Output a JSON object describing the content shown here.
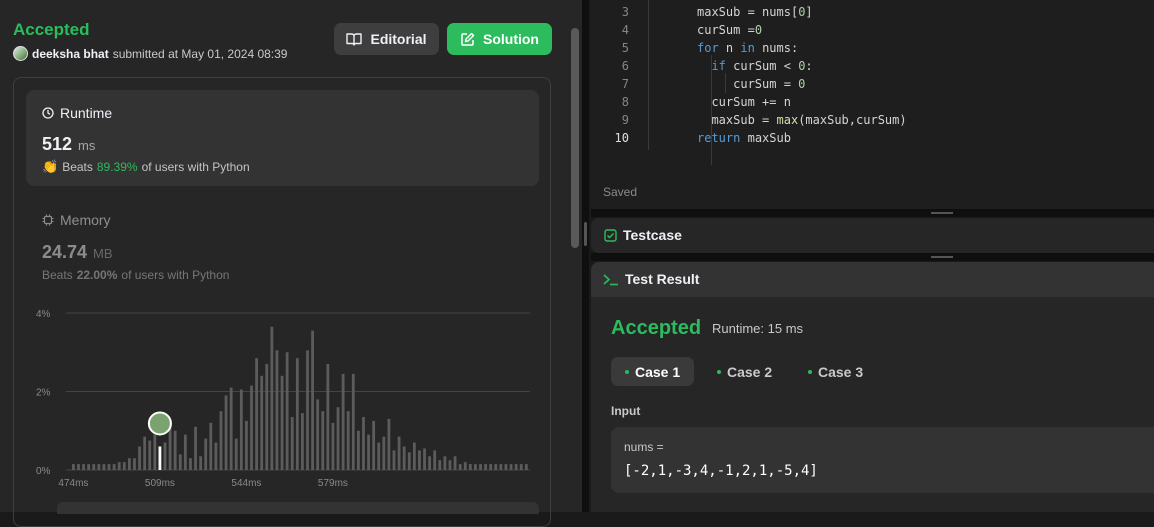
{
  "header": {
    "status": "Accepted",
    "user": "deeksha bhat",
    "submitted_text": "submitted at May 01, 2024 08:39",
    "editorial_label": "Editorial",
    "solution_label": "Solution"
  },
  "runtime": {
    "title": "Runtime",
    "value": "512",
    "unit": "ms",
    "beats_prefix": "Beats",
    "beats_pct": "89.39%",
    "beats_suffix": "of users with Python"
  },
  "memory": {
    "title": "Memory",
    "value": "24.74",
    "unit": "MB",
    "beats_prefix": "Beats",
    "beats_pct": "22.00%",
    "beats_suffix": "of users with Python"
  },
  "chart_data": {
    "type": "bar",
    "y_tick_labels": [
      "4%",
      "2%",
      "0%"
    ],
    "y_ticks": [
      4,
      2,
      0
    ],
    "x_tick_labels": [
      "474ms",
      "509ms",
      "544ms",
      "579ms"
    ],
    "x_tick_index": [
      0,
      17,
      34,
      51
    ],
    "ylim": [
      0,
      4
    ],
    "highlight_index": 17,
    "values": [
      0.15,
      0.15,
      0.15,
      0.15,
      0.15,
      0.15,
      0.15,
      0.15,
      0.15,
      0.2,
      0.2,
      0.3,
      0.3,
      0.6,
      0.85,
      0.75,
      0.9,
      0.6,
      0.7,
      1.1,
      1.0,
      0.4,
      0.9,
      0.3,
      1.1,
      0.35,
      0.8,
      1.2,
      0.7,
      1.5,
      1.9,
      2.1,
      0.8,
      2.05,
      1.25,
      2.15,
      2.85,
      2.4,
      2.7,
      3.65,
      3.05,
      2.4,
      3.0,
      1.35,
      2.85,
      1.45,
      3.05,
      3.55,
      1.8,
      1.5,
      2.7,
      1.2,
      1.6,
      2.45,
      1.5,
      2.45,
      1.0,
      1.35,
      0.9,
      1.25,
      0.7,
      0.85,
      1.3,
      0.5,
      0.85,
      0.6,
      0.45,
      0.7,
      0.5,
      0.55,
      0.35,
      0.5,
      0.25,
      0.35,
      0.25,
      0.35,
      0.15,
      0.2,
      0.15,
      0.15,
      0.15,
      0.15,
      0.15,
      0.15,
      0.15,
      0.15,
      0.15,
      0.15,
      0.15,
      0.15
    ],
    "highlight_color": "#ffffff",
    "bar_color": "#5c5c5c",
    "grid": true
  },
  "editor": {
    "lines": [
      {
        "n": "3",
        "code": "maxSub = nums[0]"
      },
      {
        "n": "4",
        "code": "curSum =0"
      },
      {
        "n": "5",
        "code": "for n in nums:"
      },
      {
        "n": "6",
        "code": "  if curSum < 0:"
      },
      {
        "n": "7",
        "code": "     curSum = 0"
      },
      {
        "n": "8",
        "code": "  curSum += n"
      },
      {
        "n": "9",
        "code": "  maxSub = max(maxSub,curSum)"
      },
      {
        "n": "10",
        "code": "return maxSub"
      }
    ],
    "saved_text": "Saved"
  },
  "testcase": {
    "label": "Testcase"
  },
  "result": {
    "tab_label": "Test Result",
    "status": "Accepted",
    "runtime_text": "Runtime: 15 ms",
    "cases": [
      "Case 1",
      "Case 2",
      "Case 3"
    ],
    "input_label": "Input",
    "var_name": "nums =",
    "var_value": "[-2,1,-3,4,-1,2,1,-5,4]"
  },
  "colors": {
    "accent": "#2cbb5d",
    "bg": "#1a1a1a",
    "panel": "#262626"
  }
}
